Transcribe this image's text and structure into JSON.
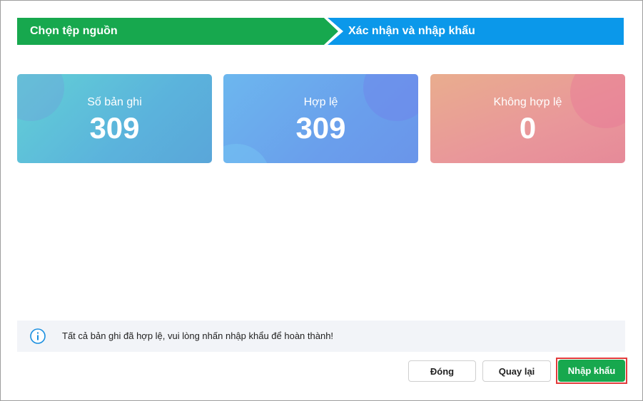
{
  "stepper": {
    "step1_label": "Chọn tệp nguồn",
    "step2_label": "Xác nhận và nhập khẩu"
  },
  "summary": {
    "total_label": "Số bản ghi",
    "total_value": "309",
    "valid_label": "Hợp lệ",
    "valid_value": "309",
    "invalid_label": "Không hợp lệ",
    "invalid_value": "0"
  },
  "info": {
    "icon": "info-icon",
    "message": "Tất cả bản ghi đã hợp lệ, vui lòng nhấn nhập khẩu để hoàn thành!"
  },
  "footer": {
    "close_label": "Đóng",
    "back_label": "Quay lại",
    "import_label": "Nhập khẩu"
  },
  "colors": {
    "step_active": "#17a84e",
    "step_next": "#0b98ea",
    "primary_button": "#17a84e",
    "highlight_outline": "#e23b3b"
  }
}
